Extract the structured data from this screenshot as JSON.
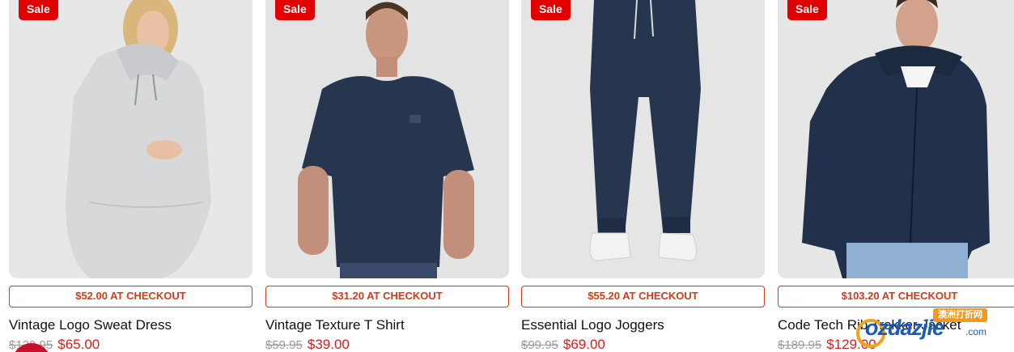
{
  "products": [
    {
      "badge": "Sale",
      "checkout": "$52.00 AT CHECKOUT",
      "name": "Vintage Logo Sweat Dress",
      "was": "$129.95",
      "now": "$65.00",
      "image": "woman-grey-hoodie-dress"
    },
    {
      "badge": "Sale",
      "checkout": "$31.20 AT CHECKOUT",
      "name": "Vintage Texture T Shirt",
      "was": "$59.95",
      "now": "$39.00",
      "image": "man-navy-tshirt"
    },
    {
      "badge": "Sale",
      "checkout": "$55.20 AT CHECKOUT",
      "name": "Essential Logo Joggers",
      "was": "$99.95",
      "now": "$69.00",
      "image": "navy-joggers-white-sneakers"
    },
    {
      "badge": "Sale",
      "checkout": "$103.20 AT CHECKOUT",
      "name": "Code Tech Rib Trekker Jacket",
      "was": "$189.95",
      "now": "$129.00",
      "image": "man-navy-jacket"
    }
  ],
  "watermark": {
    "logo": "ozdazjie",
    "suffix": ".com",
    "tag": "澳洲打折网"
  },
  "colors": {
    "sale_badge": "#e10000",
    "checkout_border": "#d23b1a",
    "price_now": "#d62020",
    "price_was": "#9a9a9a",
    "navy_garment": "#27364f"
  }
}
